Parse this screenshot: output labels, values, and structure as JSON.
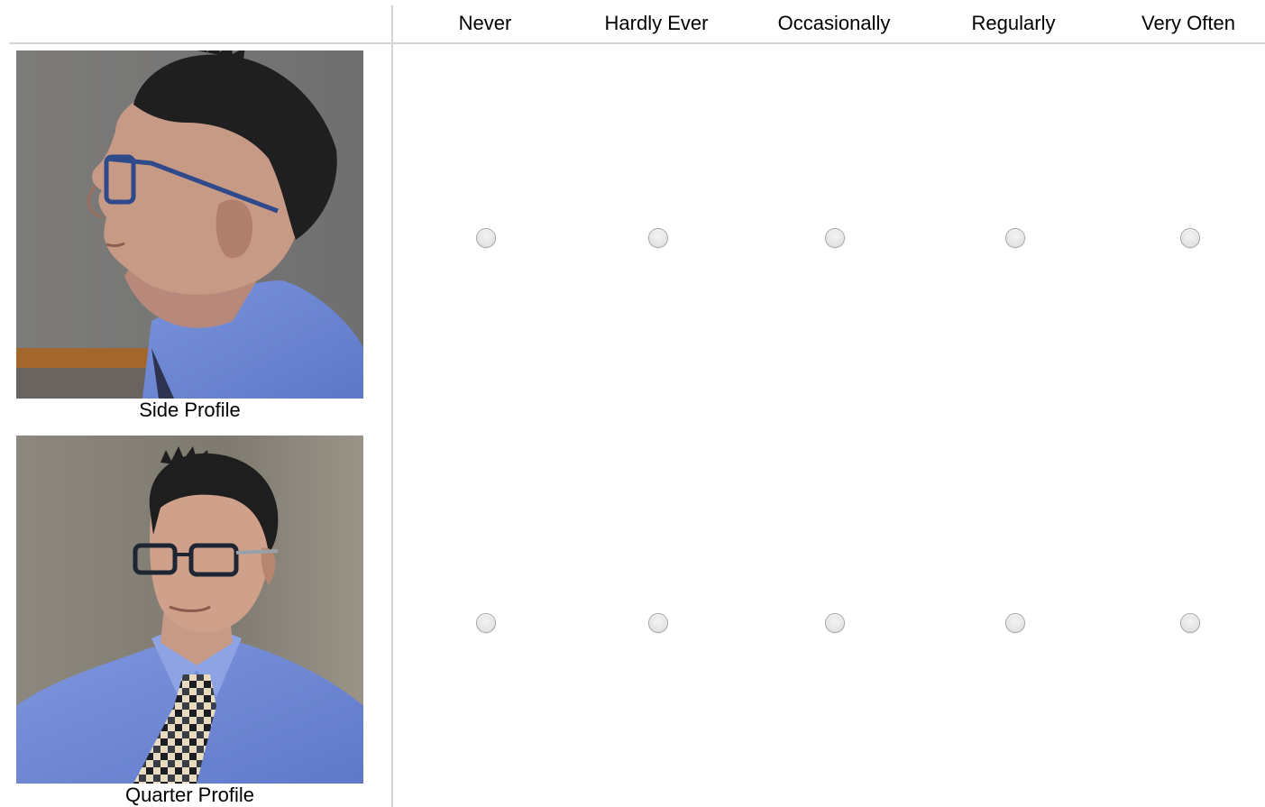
{
  "question": {
    "title": ""
  },
  "scale": {
    "options": [
      "Never",
      "Hardly Ever",
      "Occasionally",
      "Regularly",
      "Very Often"
    ]
  },
  "rows": [
    {
      "caption": "Side Profile",
      "image": "side-profile-photo",
      "selected": null
    },
    {
      "caption": "Quarter Profile",
      "image": "quarter-profile-photo",
      "selected": null
    }
  ],
  "colors": {
    "divider": "#d4d4d4",
    "radio_border": "#a6a6a6",
    "radio_fill": "#e2e2e2",
    "shirt": "#6f86d6",
    "background_wall": "#7e7a72"
  }
}
